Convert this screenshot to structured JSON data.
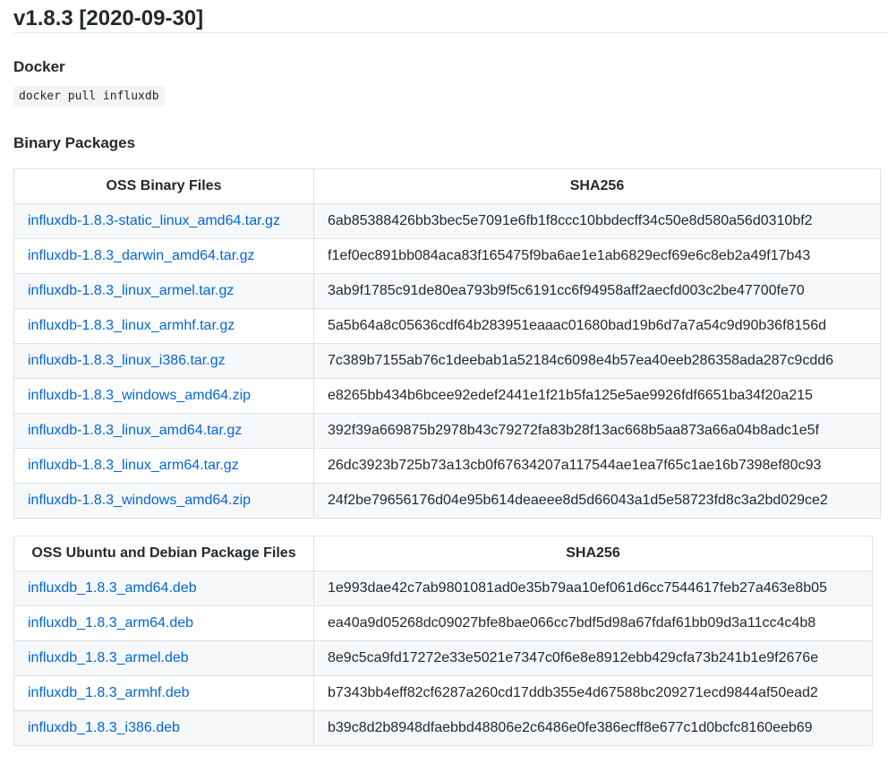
{
  "release": {
    "title": "v1.8.3 [2020-09-30]"
  },
  "docker": {
    "heading": "Docker",
    "command": "docker pull influxdb"
  },
  "binary": {
    "heading": "Binary Packages"
  },
  "oss_binary_table": {
    "headers": [
      "OSS Binary Files",
      "SHA256"
    ],
    "rows": [
      {
        "file": "influxdb-1.8.3-static_linux_amd64.tar.gz",
        "sha": "6ab85388426bb3bec5e7091e6fb1f8ccc10bbdecff34c50e8d580a56d0310bf2"
      },
      {
        "file": "influxdb-1.8.3_darwin_amd64.tar.gz",
        "sha": "f1ef0ec891bb084aca83f165475f9ba6ae1e1ab6829ecf69e6c8eb2a49f17b43"
      },
      {
        "file": "influxdb-1.8.3_linux_armel.tar.gz",
        "sha": "3ab9f1785c91de80ea793b9f5c6191cc6f94958aff2aecfd003c2be47700fe70"
      },
      {
        "file": "influxdb-1.8.3_linux_armhf.tar.gz",
        "sha": "5a5b64a8c05636cdf64b283951eaaac01680bad19b6d7a7a54c9d90b36f8156d"
      },
      {
        "file": "influxdb-1.8.3_linux_i386.tar.gz",
        "sha": "7c389b7155ab76c1deebab1a52184c6098e4b57ea40eeb286358ada287c9cdd6"
      },
      {
        "file": "influxdb-1.8.3_windows_amd64.zip",
        "sha": "e8265bb434b6bcee92edef2441e1f21b5fa125e5ae9926fdf6651ba34f20a215"
      },
      {
        "file": "influxdb-1.8.3_linux_amd64.tar.gz",
        "sha": "392f39a669875b2978b43c79272fa83b28f13ac668b5aa873a66a04b8adc1e5f"
      },
      {
        "file": "influxdb-1.8.3_linux_arm64.tar.gz",
        "sha": "26dc3923b725b73a13cb0f67634207a117544ae1ea7f65c1ae16b7398ef80c93"
      },
      {
        "file": "influxdb-1.8.3_windows_amd64.zip",
        "sha": "24f2be79656176d04e95b614deaeee8d5d66043a1d5e58723fd8c3a2bd029ce2"
      }
    ]
  },
  "oss_deb_table": {
    "headers": [
      "OSS Ubuntu and Debian Package Files",
      "SHA256"
    ],
    "rows": [
      {
        "file": "influxdb_1.8.3_amd64.deb",
        "sha": "1e993dae42c7ab9801081ad0e35b79aa10ef061d6cc7544617feb27a463e8b05"
      },
      {
        "file": "influxdb_1.8.3_arm64.deb",
        "sha": "ea40a9d05268dc09027bfe8bae066cc7bdf5d98a67fdaf61bb09d3a11cc4c4b8"
      },
      {
        "file": "influxdb_1.8.3_armel.deb",
        "sha": "8e9c5ca9fd17272e33e5021e7347c0f6e8e8912ebb429cfa73b241b1e9f2676e"
      },
      {
        "file": "influxdb_1.8.3_armhf.deb",
        "sha": "b7343bb4eff82cf6287a260cd17ddb355e4d67588bc209271ecd9844af50ead2"
      },
      {
        "file": "influxdb_1.8.3_i386.deb",
        "sha": "b39c8d2b8948dfaebbd48806e2c6486e0fe386ecff8e677c1d0bcfc8160eeb69"
      }
    ]
  },
  "colors": {
    "link": "#0366d6",
    "text": "#24292e",
    "border": "#dfe2e5",
    "row_alt": "#f6f8fa"
  }
}
